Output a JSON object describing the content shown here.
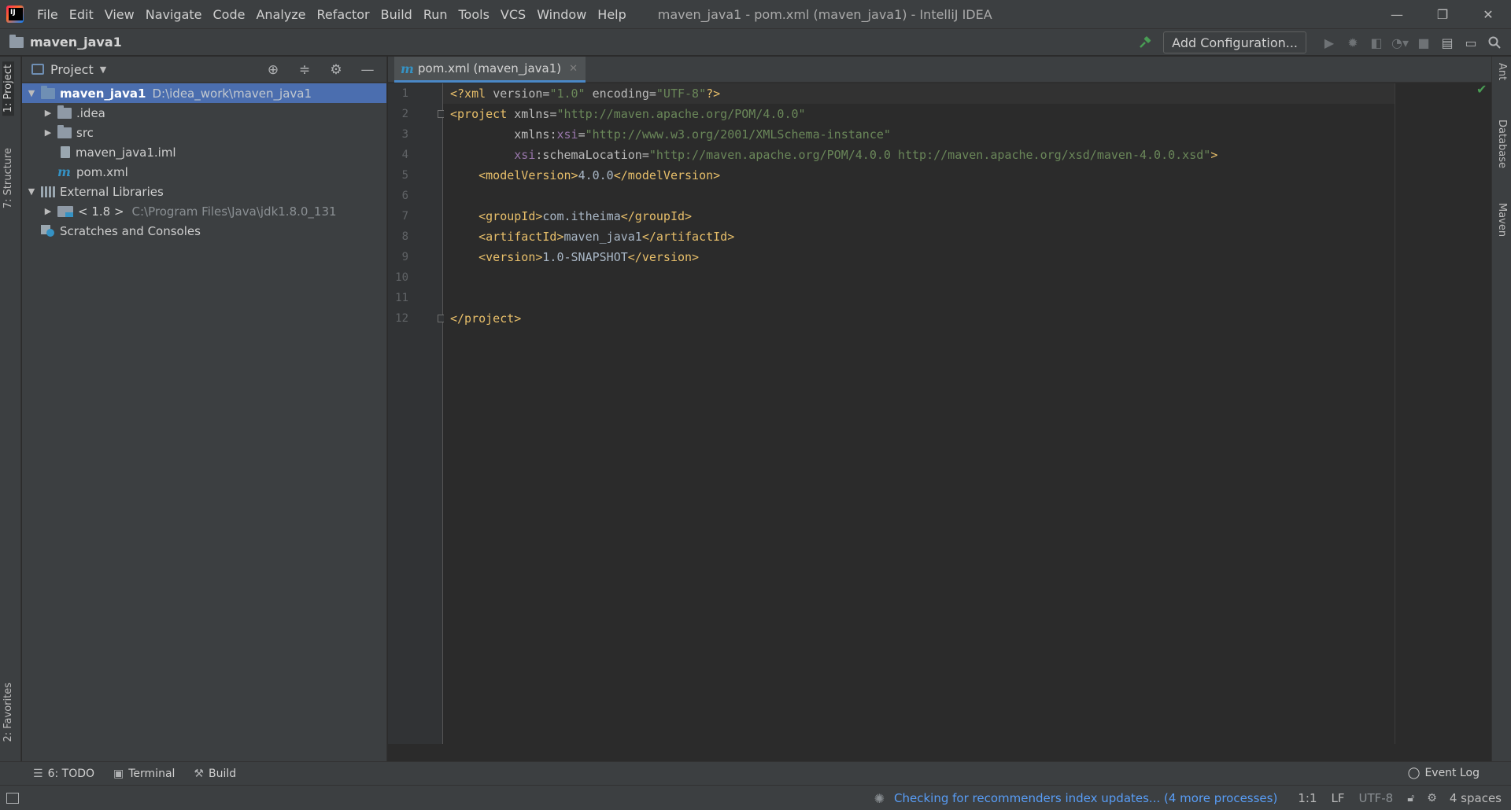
{
  "menu": [
    "File",
    "Edit",
    "View",
    "Navigate",
    "Code",
    "Analyze",
    "Refactor",
    "Build",
    "Run",
    "Tools",
    "VCS",
    "Window",
    "Help"
  ],
  "window_title": "maven_java1 - pom.xml (maven_java1) - IntelliJ IDEA",
  "window_controls": {
    "minimize": "—",
    "restore": "❐",
    "close": "✕"
  },
  "navbar": {
    "project_name": "maven_java1",
    "add_configuration": "Add Configuration..."
  },
  "left_strip": {
    "project_tab": "1: Project",
    "structure_tab": "7: Structure",
    "favorites_tab": "2: Favorites"
  },
  "right_strip": {
    "ant": "Ant",
    "database": "Database",
    "maven": "Maven"
  },
  "project_panel": {
    "title": "Project",
    "tree": {
      "root_name": "maven_java1",
      "root_path": "D:\\idea_work\\maven_java1",
      "idea": ".idea",
      "src": "src",
      "iml": "maven_java1.iml",
      "pom": "pom.xml",
      "external_libraries": "External Libraries",
      "jdk_name": "< 1.8 >",
      "jdk_path": "C:\\Program Files\\Java\\jdk1.8.0_131",
      "scratches": "Scratches and Consoles"
    }
  },
  "editor": {
    "tab_label": "pom.xml (maven_java1)",
    "line_numbers": [
      "1",
      "2",
      "3",
      "4",
      "5",
      "6",
      "7",
      "8",
      "9",
      "10",
      "11",
      "12"
    ],
    "l1": {
      "open": "<?xml ",
      "a1": "version",
      "eq1": "=",
      "v1": "\"1.0\"",
      "a2": " encoding",
      "eq2": "=",
      "v2": "\"UTF-8\"",
      "close": "?>"
    },
    "l2": {
      "open": "<project ",
      "a1": "xmlns",
      "eq": "=",
      "v1": "\"http://maven.apache.org/POM/4.0.0\""
    },
    "l3": {
      "indent": "         ",
      "a1": "xmlns",
      "colon": ":",
      "ns": "xsi",
      "eq": "=",
      "v1": "\"http://www.w3.org/2001/XMLSchema-instance\""
    },
    "l4": {
      "indent": "         ",
      "ns": "xsi",
      "colon": ":",
      "a1": "schemaLocation",
      "eq": "=",
      "v1": "\"http://maven.apache.org/POM/4.0.0 http://maven.apache.org/xsd/maven-4.0.0.xsd\"",
      "close": ">"
    },
    "l5": {
      "indent": "    ",
      "open": "<modelVersion>",
      "text": "4.0.0",
      "close": "</modelVersion>"
    },
    "l7": {
      "indent": "    ",
      "open": "<groupId>",
      "text": "com.itheima",
      "close": "</groupId>"
    },
    "l8": {
      "indent": "    ",
      "open": "<artifactId>",
      "text": "maven_java1",
      "close": "</artifactId>"
    },
    "l9": {
      "indent": "    ",
      "open": "<version>",
      "text": "1.0-SNAPSHOT",
      "close": "</version>"
    },
    "l12": {
      "close": "</project>"
    }
  },
  "bottom_tools": {
    "todo": "6: TODO",
    "terminal": "Terminal",
    "build": "Build",
    "event_log": "Event Log"
  },
  "status": {
    "progress": "Checking for recommenders index updates... (4 more processes)",
    "position": "1:1",
    "line_sep": "LF",
    "encoding": "UTF-8",
    "indent": "4 spaces"
  },
  "colors": {
    "tag": "#e8bf6a",
    "string": "#6a8759",
    "namespace": "#9876aa",
    "selection": "#4b6eaf",
    "link": "#589df6"
  }
}
